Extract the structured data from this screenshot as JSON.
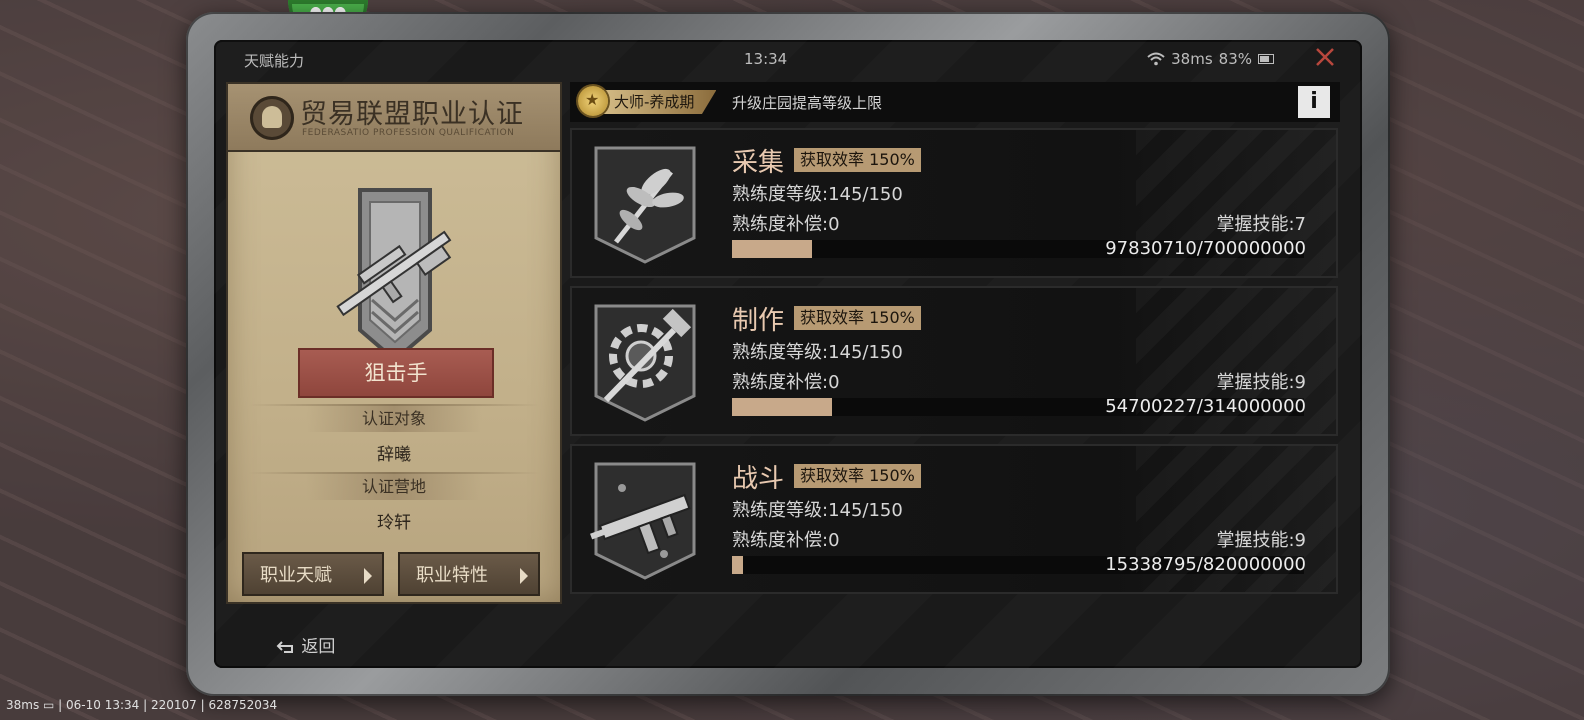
{
  "status": {
    "title": "天赋能力",
    "time": "13:34",
    "ping": "38ms",
    "battery": "83%"
  },
  "cert": {
    "title": "贸易联盟职业认证",
    "subtitle": "FEDERASATIO PROFESSION QUALIFICATION",
    "class_name": "狙击手",
    "target_label": "认证对象",
    "target_value": "辞曦",
    "camp_label": "认证营地",
    "camp_value": "玲轩",
    "btn_talent": "职业天赋",
    "btn_trait": "职业特性"
  },
  "rank": {
    "tag": "大师-养成期",
    "text": "升级庄园提高等级上限",
    "info": "i"
  },
  "skills": [
    {
      "name": "采集",
      "efficiency": "获取效率 150%",
      "level": "熟练度等级:145/150",
      "compensation": "熟练度补偿:0",
      "mastery": "掌握技能:7",
      "progress_text": "97830710/700000000",
      "progress": 0.1398,
      "icon": "leaf-icon"
    },
    {
      "name": "制作",
      "efficiency": "获取效率 150%",
      "level": "熟练度等级:145/150",
      "compensation": "熟练度补偿:0",
      "mastery": "掌握技能:9",
      "progress_text": "54700227/314000000",
      "progress": 0.1742,
      "icon": "gear-hammer-icon"
    },
    {
      "name": "战斗",
      "efficiency": "获取效率 150%",
      "level": "熟练度等级:145/150",
      "compensation": "熟练度补偿:0",
      "mastery": "掌握技能:9",
      "progress_text": "15338795/820000000",
      "progress": 0.0187,
      "icon": "smg-icon"
    }
  ],
  "back": "返回",
  "overlay": "38ms ▭ | 06-10 13:34 | 220107 | 628752034",
  "colors": {
    "accent": "#c8a98a",
    "close": "#b8473d",
    "cert_bg": "#c2b08a"
  }
}
